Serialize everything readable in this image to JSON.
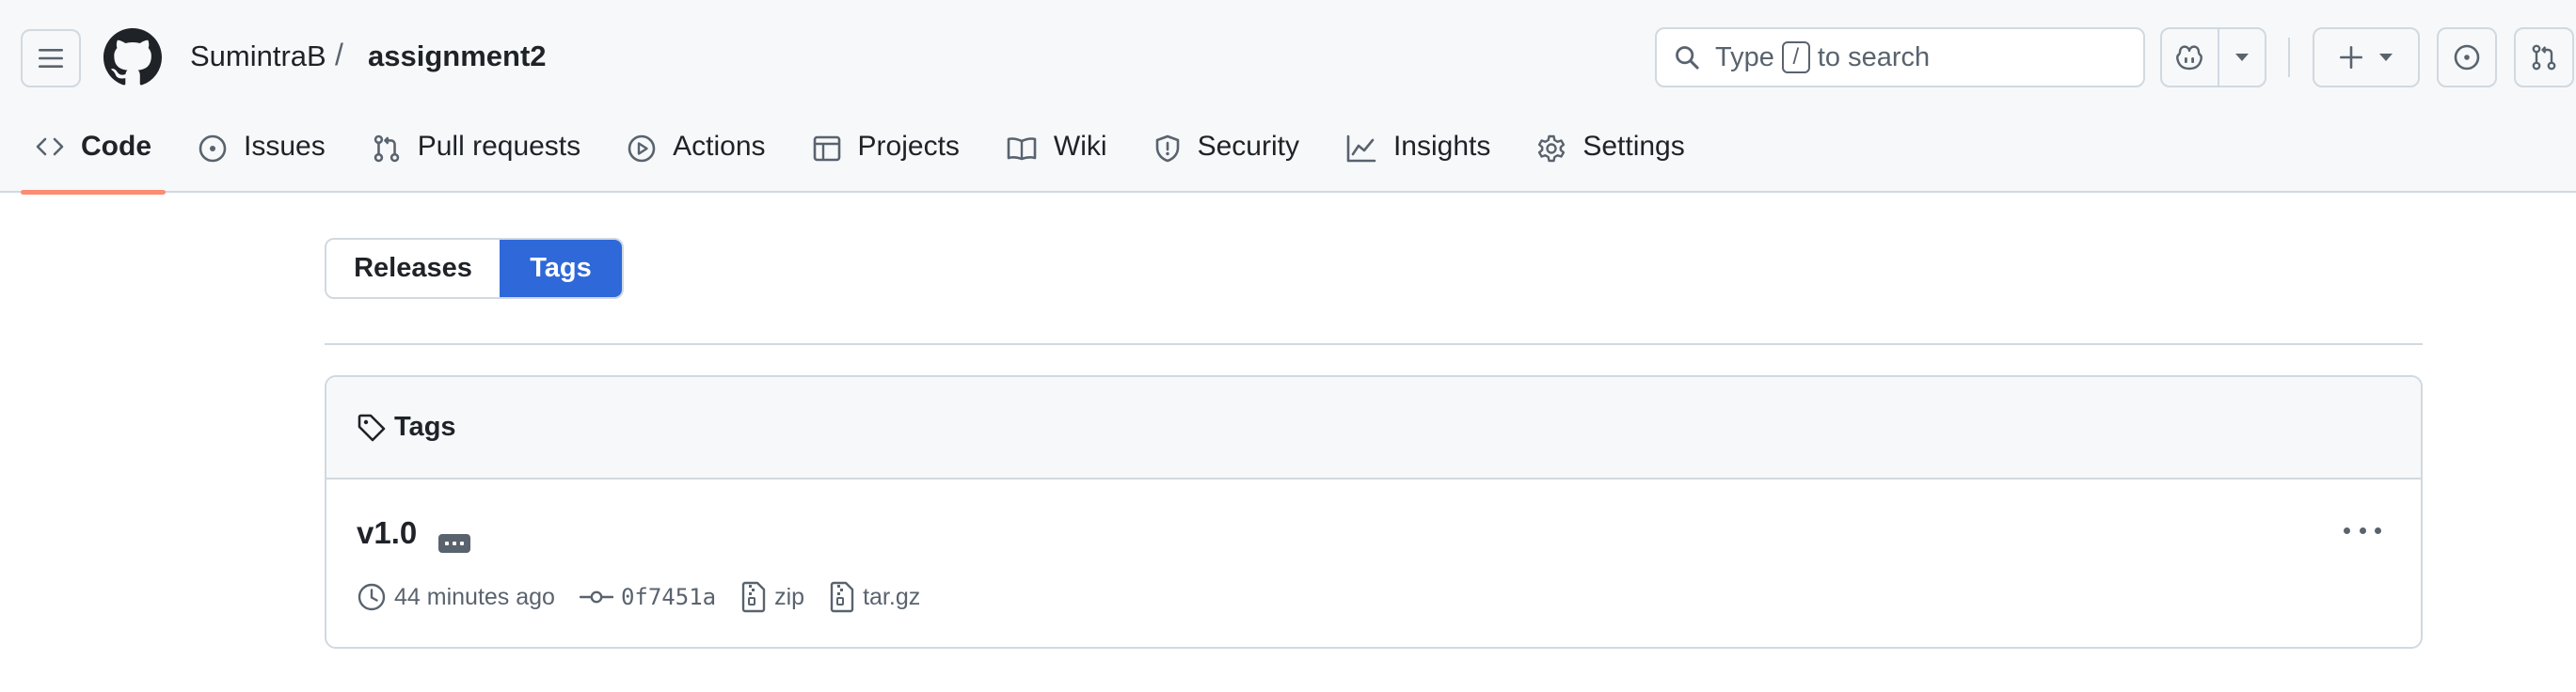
{
  "header": {
    "owner": "SumintraB",
    "separator": "/",
    "repo": "assignment2",
    "search": {
      "prefix": "Type",
      "key": "/",
      "suffix": "to search"
    }
  },
  "tabs": [
    {
      "label": "Code",
      "icon": "code-icon",
      "active": true
    },
    {
      "label": "Issues",
      "icon": "issue-opened-icon"
    },
    {
      "label": "Pull requests",
      "icon": "git-pull-request-icon"
    },
    {
      "label": "Actions",
      "icon": "play-icon"
    },
    {
      "label": "Projects",
      "icon": "table-icon"
    },
    {
      "label": "Wiki",
      "icon": "book-icon"
    },
    {
      "label": "Security",
      "icon": "shield-icon"
    },
    {
      "label": "Insights",
      "icon": "graph-icon"
    },
    {
      "label": "Settings",
      "icon": "gear-icon"
    }
  ],
  "segmented": {
    "releases": "Releases",
    "tags": "Tags",
    "selected": "Tags"
  },
  "tags_box": {
    "title": "Tags",
    "items": [
      {
        "name": "v1.0",
        "time": "44 minutes ago",
        "commit": "0f7451a",
        "zip": "zip",
        "targz": "tar.gz"
      }
    ]
  },
  "colors": {
    "accent": "#2f68d8",
    "active_tab_underline": "#fd8c73",
    "header_bg": "#f6f8fa",
    "border": "#d1d9e0",
    "muted": "#59636e"
  }
}
